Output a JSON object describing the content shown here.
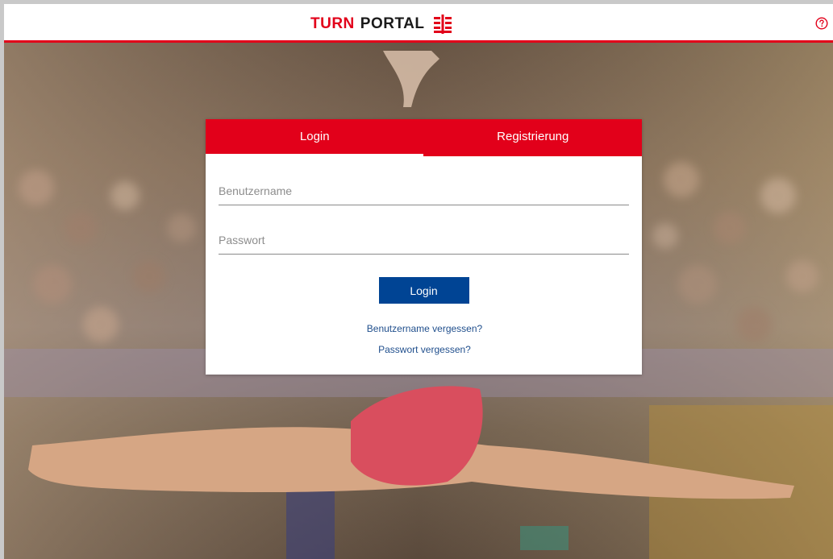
{
  "header": {
    "brand_word1": "TURN",
    "brand_word2": "PORTAL",
    "logo_icon": "dtb-logo-icon",
    "help_icon": "help-circle-icon"
  },
  "tabs": [
    {
      "label": "Login",
      "active": true
    },
    {
      "label": "Registrierung",
      "active": false
    }
  ],
  "form": {
    "username_placeholder": "Benutzername",
    "password_placeholder": "Passwort",
    "submit_label": "Login",
    "forgot_username": "Benutzername vergessen?",
    "forgot_password": "Passwort vergessen?"
  },
  "colors": {
    "brand_red": "#e2001a",
    "button_blue": "#004494",
    "link_blue": "#1f4e8c"
  }
}
